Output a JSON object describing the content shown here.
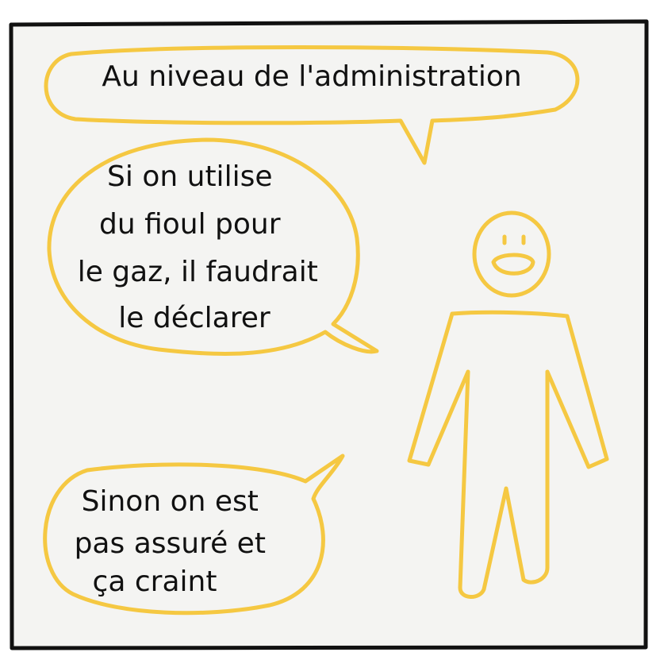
{
  "colors": {
    "background": "#f4f4f2",
    "frame": "#111111",
    "outline": "#f5c842",
    "text": "#111111"
  },
  "bubbles": [
    {
      "lines": [
        "Au niveau de l'administration"
      ]
    },
    {
      "lines": [
        "Si on utilise",
        "du fioul pour",
        "le gaz, il faudrait",
        "le déclarer"
      ]
    },
    {
      "lines": [
        "Sinon on est",
        "pas assuré et",
        "ça craint"
      ]
    }
  ],
  "character": {
    "expression": "smiling"
  }
}
